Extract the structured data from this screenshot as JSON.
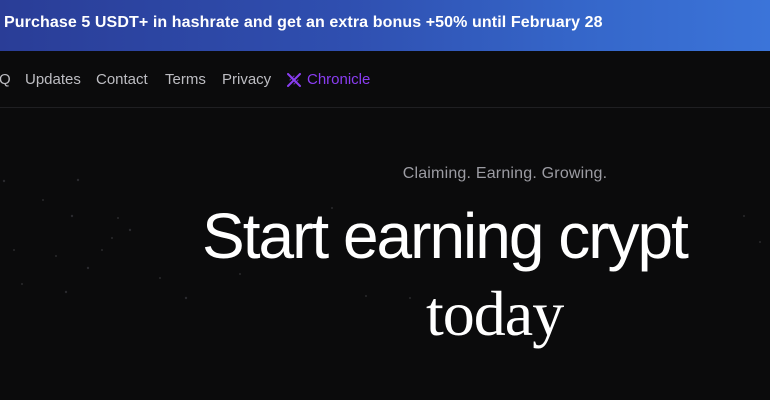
{
  "promo": {
    "text": "- Purchase 5 USDT+ in hashrate and get an extra bonus +50% until February 28"
  },
  "nav": {
    "items": [
      {
        "label": "Q"
      },
      {
        "label": "Updates"
      },
      {
        "label": "Contact"
      },
      {
        "label": "Terms"
      },
      {
        "label": "Privacy"
      }
    ],
    "chronicle": {
      "label": "Chronicle",
      "icon": "x-icon",
      "color": "#8a3df2"
    }
  },
  "hero": {
    "tagline": "Claiming. Earning. Growing.",
    "headline": "Start earning crypt",
    "headline_serif": "today"
  },
  "colors": {
    "background": "#0b0b0c",
    "banner_start": "#2a3d97",
    "banner_end": "#3b74d9",
    "nav_text": "#bdbdc2",
    "tagline_text": "#9c9ca3"
  }
}
